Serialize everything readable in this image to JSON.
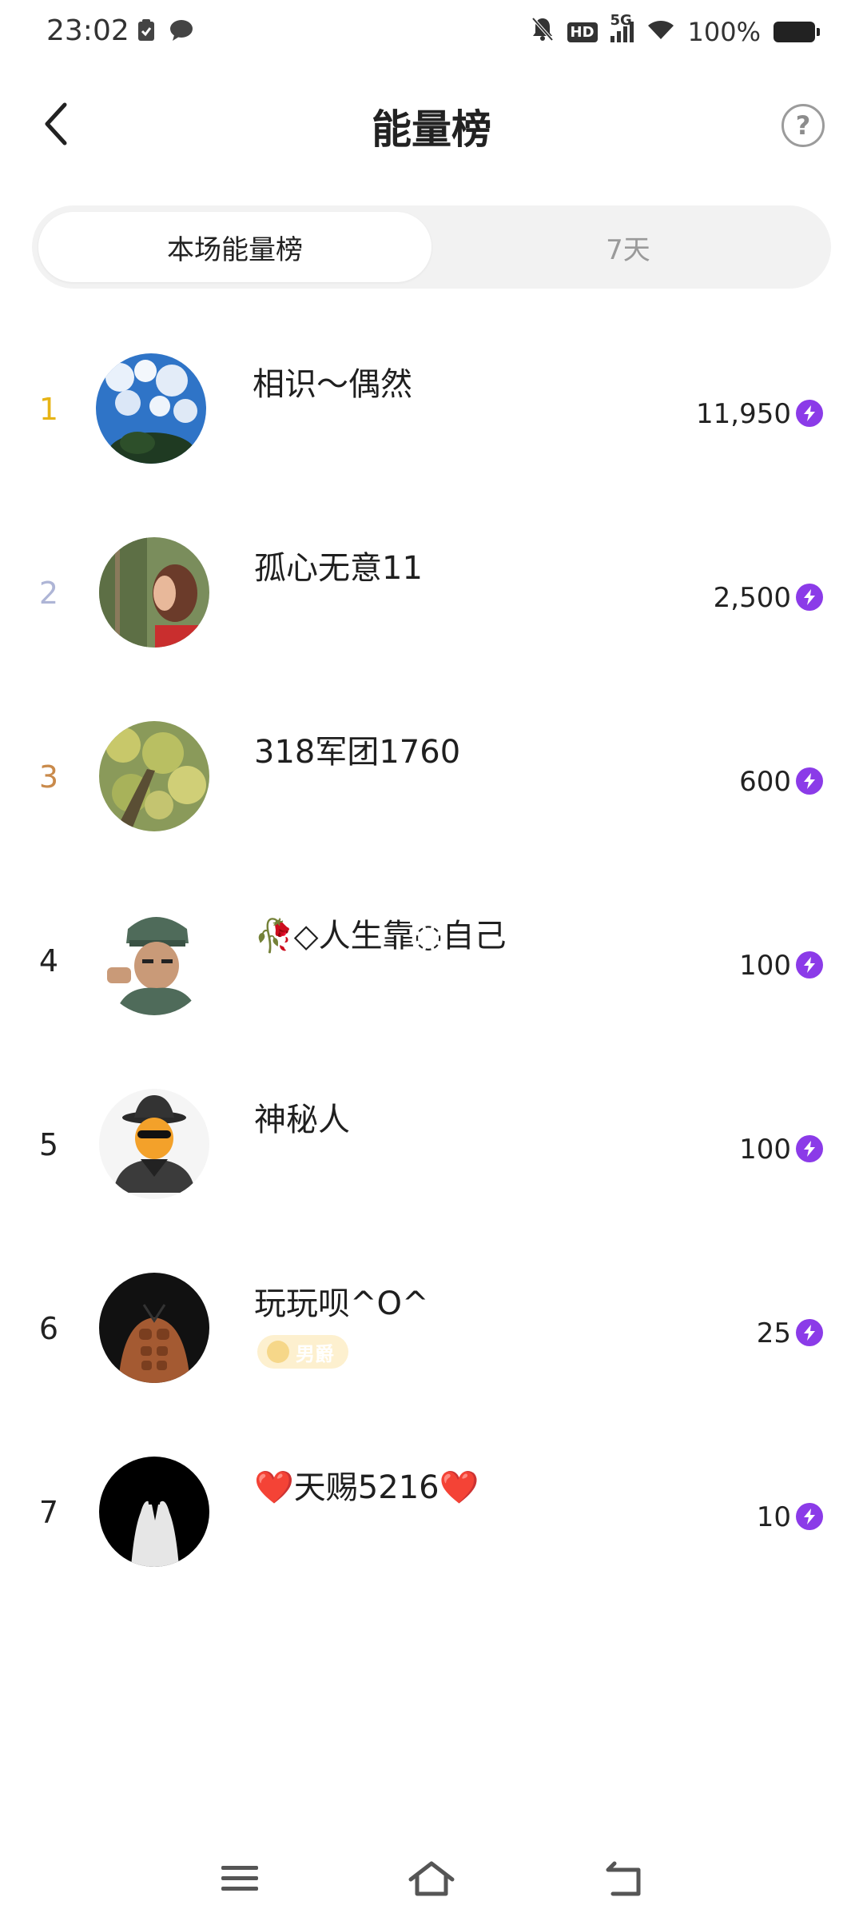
{
  "status_bar": {
    "time": "23:02",
    "battery": "100%",
    "network": "5G",
    "hd": "HD",
    "icons": [
      "clipboard-check-icon",
      "chat-bubble-icon",
      "mute-bell-icon",
      "signal-icon",
      "wifi-icon",
      "battery-icon"
    ]
  },
  "header": {
    "title": "能量榜",
    "back_icon": "chevron-left-icon",
    "help_label": "?"
  },
  "tabs": [
    {
      "label": "本场能量榜",
      "active": true
    },
    {
      "label": "7天",
      "active": false
    }
  ],
  "ranking": [
    {
      "rank": "1",
      "name": "相识～偶然",
      "score": "11,950",
      "rank_color": "#e7b416"
    },
    {
      "rank": "2",
      "name": "孤心无意11",
      "score": "2,500",
      "rank_color": "#aeb5d6"
    },
    {
      "rank": "3",
      "name": "318军团1760",
      "score": "600",
      "rank_color": "#c98a4b"
    },
    {
      "rank": "4",
      "name": "🥀◇人生靠◌自己",
      "score": "100",
      "rank_color": "#222222"
    },
    {
      "rank": "5",
      "name": "神秘人",
      "score": "100",
      "rank_color": "#222222"
    },
    {
      "rank": "6",
      "name": "玩玩呗^O^",
      "score": "25",
      "rank_color": "#222222",
      "badge": "男爵"
    },
    {
      "rank": "7",
      "name": "❤️天赐5216❤️",
      "score": "10",
      "rank_color": "#222222"
    }
  ],
  "energy_icon": "lightning-bolt-icon",
  "colors": {
    "energy": "#8b3be8",
    "tab_bg": "#f2f2f2"
  },
  "navbar": [
    "menu-icon",
    "home-icon",
    "back-icon"
  ]
}
